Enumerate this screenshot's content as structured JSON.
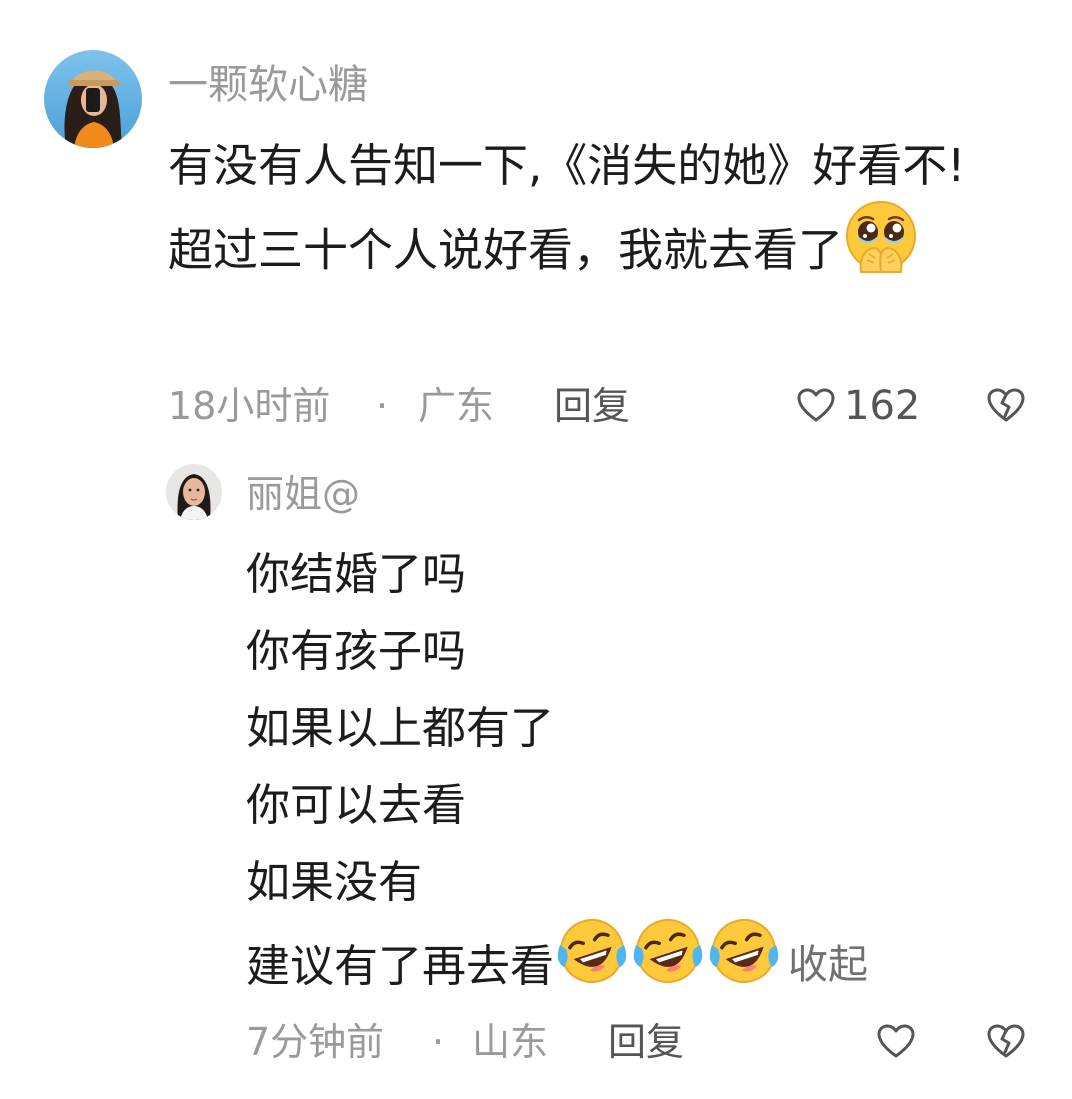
{
  "main_comment": {
    "username": "一颗软心糖",
    "text": "有没有人告知一下,《消失的她》好看不! 超过三十个人说好看，我就去看了",
    "emoji_icon": "pleading-face-hands-over-mouth-icon",
    "time": "18小时前",
    "separator": "·",
    "location": "广东",
    "reply_label": "回复",
    "like_count": "162",
    "like_icon": "heart-outline-icon",
    "dislike_icon": "broken-heart-icon"
  },
  "reply_comment": {
    "username": "丽姐@",
    "lines": [
      "你结婚了吗",
      "你有孩子吗",
      "如果以上都有了",
      "你可以去看",
      "如果没有",
      "建议有了再去看"
    ],
    "emoji_icons": [
      "rolling-laughing-face-icon",
      "rolling-laughing-face-icon",
      "rolling-laughing-face-icon"
    ],
    "collapse_label": "收起",
    "time": "7分钟前",
    "separator": "·",
    "location": "山东",
    "reply_label": "回复",
    "like_icon": "heart-outline-icon",
    "dislike_icon": "broken-heart-icon"
  },
  "colors": {
    "text": "#1c1c1c",
    "meta": "#9a9a9a",
    "action": "#555555",
    "emoji_yellow": "#ffc93c"
  }
}
